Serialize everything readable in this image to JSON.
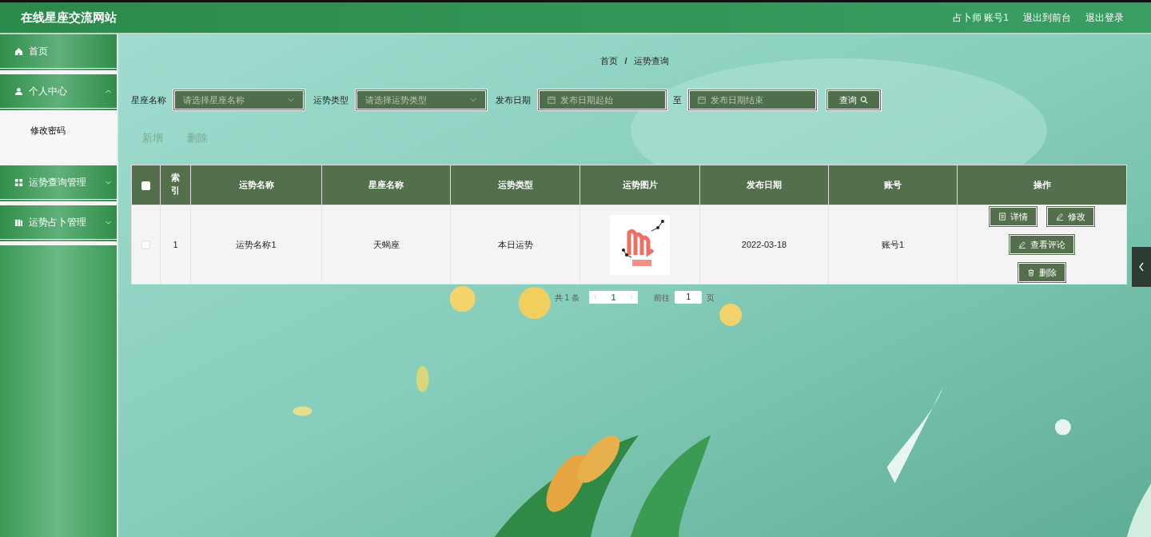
{
  "header": {
    "title": "在线星座交流网站",
    "user": "占卜师 账号1",
    "links": [
      "退出到前台",
      "退出登录"
    ]
  },
  "sidebar": {
    "items": [
      {
        "label": "首页"
      },
      {
        "label": "个人中心",
        "expanded": true,
        "children": [
          {
            "label": "修改密码"
          }
        ]
      },
      {
        "label": "运势查询管理",
        "expanded": false
      },
      {
        "label": "运势占卜管理",
        "expanded": false
      }
    ]
  },
  "breadcrumb": {
    "items": [
      "首页",
      "运势查询"
    ],
    "separator": "/"
  },
  "filters": [
    {
      "kind": "select",
      "label": "星座名称",
      "placeholder": "请选择星座名称"
    },
    {
      "kind": "select",
      "label": "运势类型",
      "placeholder": "请选择运势类型"
    },
    {
      "kind": "daterange",
      "label": "发布日期",
      "start_placeholder": "发布日期起始",
      "separator": "至",
      "end_placeholder": "发布日期结束"
    }
  ],
  "search_button": "查询",
  "actions": [
    "新增",
    "删除"
  ],
  "table": {
    "select_all_checked": false,
    "columns": [
      "索引",
      "运势名称",
      "星座名称",
      "运势类型",
      "运势图片",
      "发布日期",
      "账号",
      "操作"
    ],
    "rows": [
      {
        "checked": false,
        "cells": [
          "1",
          "运势名称1",
          "天蝎座",
          "本日运势",
          {
            "kind": "picture"
          },
          "2022-03-18",
          "账号1"
        ],
        "buttons": [
          "详情",
          "修改",
          "查看评论",
          "删除"
        ]
      }
    ]
  },
  "pagination": {
    "total_prefix": "共",
    "total": "1",
    "total_suffix": "条",
    "current_page": "1",
    "goto_label": "前往",
    "goto_value": "1",
    "goto_suffix": "页"
  }
}
